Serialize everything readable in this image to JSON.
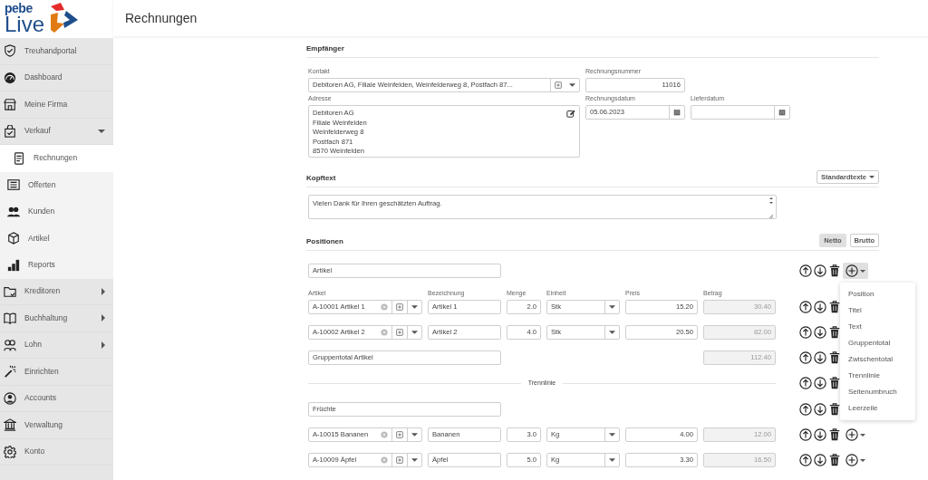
{
  "logo": {
    "top": "pebe",
    "bottom": "Live"
  },
  "sidebar": {
    "items": [
      {
        "label": "Treuhandportal",
        "kind": "item",
        "selected": false
      },
      {
        "label": "Dashboard",
        "kind": "item",
        "selected": false
      },
      {
        "label": "Meine Firma",
        "kind": "item",
        "selected": false
      },
      {
        "label": "Verkauf",
        "kind": "group",
        "expanded": true,
        "selected": false,
        "children": [
          {
            "label": "Rechnungen",
            "selected": true
          },
          {
            "label": "Offerten",
            "selected": false
          },
          {
            "label": "Kunden",
            "selected": false
          },
          {
            "label": "Artikel",
            "selected": false
          },
          {
            "label": "Reports",
            "selected": false
          }
        ]
      },
      {
        "label": "Kreditoren",
        "kind": "group",
        "expanded": false,
        "selected": false
      },
      {
        "label": "Buchhaltung",
        "kind": "group",
        "expanded": false,
        "selected": false
      },
      {
        "label": "Lohn",
        "kind": "group",
        "expanded": false,
        "selected": false
      },
      {
        "label": "Einrichten",
        "kind": "item",
        "selected": false
      },
      {
        "label": "Accounts",
        "kind": "item",
        "selected": false
      },
      {
        "label": "Verwaltung",
        "kind": "item",
        "selected": false
      },
      {
        "label": "Konto",
        "kind": "item",
        "selected": false
      }
    ]
  },
  "page": {
    "title": "Rechnungen"
  },
  "recipient": {
    "title": "Empfänger",
    "contact": {
      "label": "Kontakt",
      "value": "Debitoren AG, Filiale Weinfelden, Weinfelderweg 8, Postfach 87..."
    },
    "address": {
      "label": "Adresse",
      "lines": [
        "Debitoren AG",
        "Filiale Weinfelden",
        "Weinfelderweg 8",
        "Postfach 871",
        "8570 Weinfelden"
      ]
    },
    "invoice_number": {
      "label": "Rechnungsnummer",
      "value": "11016"
    },
    "invoice_date": {
      "label": "Rechnungsdatum",
      "value": "05.06.2023"
    },
    "delivery_date": {
      "label": "Lieferdatum"
    }
  },
  "header_text": {
    "title": "Kopftext",
    "templates": "Standardtexte",
    "value": "Vielen Dank für Ihren geschätzten Auftrag."
  },
  "positions": {
    "title": "Positionen",
    "modes": [
      {
        "label": "Netto",
        "selected": true
      },
      {
        "label": "Brutto",
        "selected": false
      }
    ],
    "columns": [
      "Artikel",
      "Bezeichnung",
      "Menge",
      "Einheit",
      "Preis",
      "Betrag"
    ],
    "rows": [
      {
        "kind": "title",
        "value": "Artikel",
        "menu_open": true
      },
      {
        "kind": "article",
        "article": "A-10001 Artikel 1",
        "description": "Artikel 1",
        "quantity": "2.0",
        "unit": "Stk",
        "price": "15.20",
        "amount": "30.40",
        "menu_open": false
      },
      {
        "kind": "article",
        "article": "A-10002 Artikel 2",
        "description": "Artikel 2",
        "quantity": "4.0",
        "unit": "Stk",
        "price": "20.50",
        "amount": "82.00",
        "menu_open": false
      },
      {
        "kind": "group_total",
        "value": "Gruppentotal Artikel",
        "amount": "112.40",
        "menu_open": false
      },
      {
        "kind": "separator",
        "label": "Trennlinie",
        "menu_open": false
      },
      {
        "kind": "title",
        "value": "Früchte",
        "menu_open": false
      },
      {
        "kind": "article",
        "article": "A-10015 Bananen",
        "description": "Bananen",
        "quantity": "3.0",
        "unit": "Kg",
        "price": "4.00",
        "amount": "12.00",
        "menu_open": false
      },
      {
        "kind": "article",
        "article": "A-10009 Äpfel",
        "description": "Äpfel",
        "quantity": "5.0",
        "unit": "Kg",
        "price": "3.30",
        "amount": "16.50",
        "menu_open": false
      }
    ],
    "add_menu": [
      "Position",
      "Titel",
      "Text",
      "Gruppentotal",
      "Zwischentotal",
      "Trennlinie",
      "Seitenumbruch",
      "Leerzeile"
    ]
  }
}
